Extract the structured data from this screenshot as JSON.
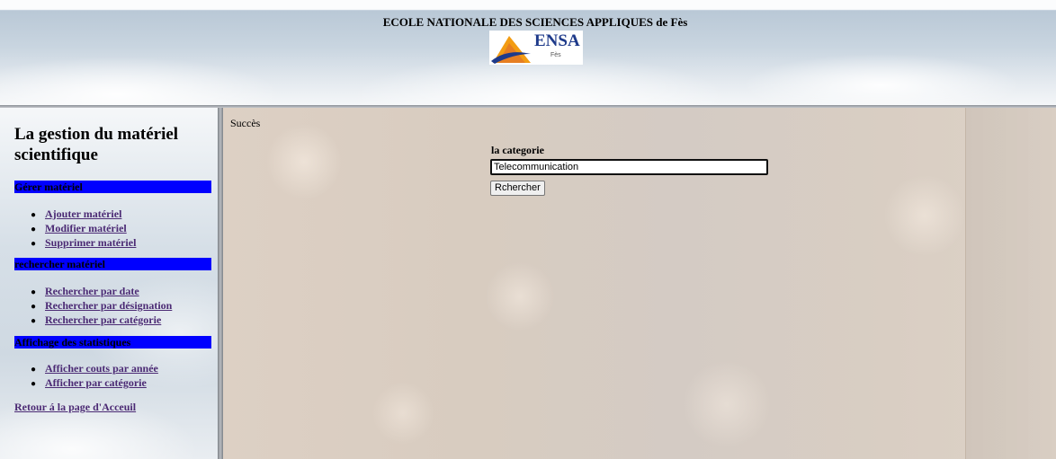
{
  "header": {
    "title": "ECOLE NATIONALE DES SCIENCES APPLIQUES de Fès",
    "logo_text": "ENSA",
    "logo_sub": "Fès"
  },
  "sidebar": {
    "title": "La gestion du matériel scientifique",
    "sections": [
      {
        "header": "Gérer matériel",
        "items": [
          "Ajouter matériel",
          "Modifier matériel",
          "Supprimer matériel"
        ]
      },
      {
        "header": "rechercher matériel",
        "items": [
          "Rechercher par date",
          "Rechercher par désignation",
          "Rechercher par catégorie"
        ]
      },
      {
        "header": "Affichage des statistiques",
        "items": [
          "Afficher couts par année",
          "Afficher par catégorie"
        ]
      }
    ],
    "back_link": "Retour á la page d'Acceuil"
  },
  "main": {
    "status": "Succès",
    "form_label": "la categorie",
    "input_value": "Telecommunication",
    "button_label": "Rchercher"
  },
  "colors": {
    "section_header_bg": "#0000ff",
    "link": "#4b2a74"
  }
}
